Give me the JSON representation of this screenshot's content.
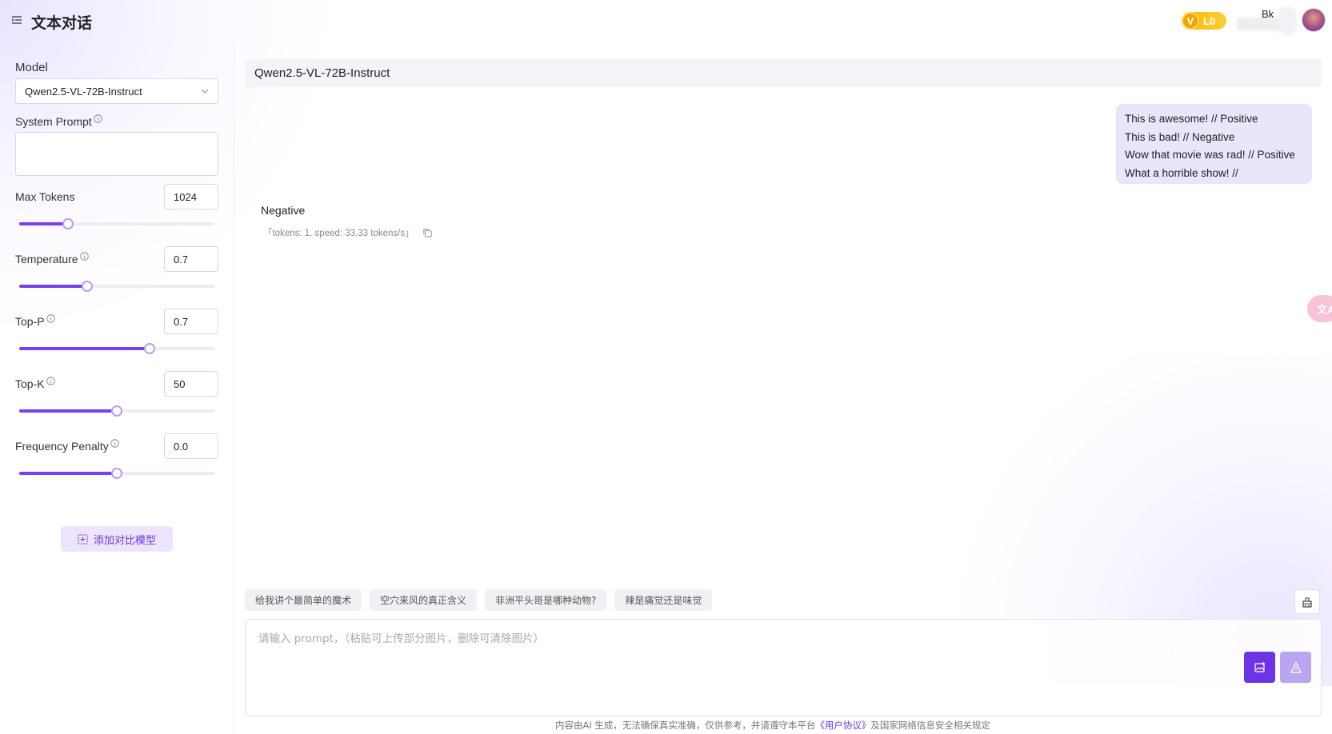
{
  "header": {
    "title": "文本对话",
    "vip_letter": "V",
    "vip_level": "L0",
    "user_name": "Bk"
  },
  "sidebar": {
    "model_label": "Model",
    "model_value": "Qwen2.5-VL-72B-Instruct",
    "system_prompt_label": "System Prompt",
    "system_prompt_value": "",
    "params": [
      {
        "label": "Max Tokens",
        "value": "1024",
        "slider_fraction": 0.25
      },
      {
        "label": "Temperature",
        "value": "0.7",
        "slider_fraction": 0.35
      },
      {
        "label": "Top-P",
        "value": "0.7",
        "slider_fraction": 0.67
      },
      {
        "label": "Top-K",
        "value": "50",
        "slider_fraction": 0.5
      },
      {
        "label": "Frequency Penalty",
        "value": "0.0",
        "slider_fraction": 0.5
      }
    ],
    "compare_button": "添加对比模型"
  },
  "main": {
    "model_bar": "Qwen2.5-VL-72B-Instruct",
    "user_message": [
      "This is awesome! // Positive",
      "This is bad! // Negative",
      "Wow that movie was rad! // Positive",
      "What a horrible show! //"
    ],
    "reply": "Negative",
    "reply_meta": "「tokens: 1, speed: 33.33 tokens/s」",
    "translate_label": "文A"
  },
  "chips": [
    "给我讲个最简单的魔术",
    "空穴来风的真正含义",
    "非洲平头哥是哪种动物?",
    "辣是痛觉还是味觉"
  ],
  "prompt": {
    "placeholder": "请输入 prompt，（粘贴可上传部分图片，删除可清除图片）"
  },
  "footer": {
    "before": "内容由AI 生成，无法确保真实准确，仅供参考，并请遵守本平台",
    "link": "《用户协议》",
    "after": "及国家网络信息安全相关规定"
  },
  "colors": {
    "accent": "#7b3ff2",
    "accent_light": "#ede5ff",
    "bubble": "#ebe5fb",
    "vip": "#f6b800"
  }
}
